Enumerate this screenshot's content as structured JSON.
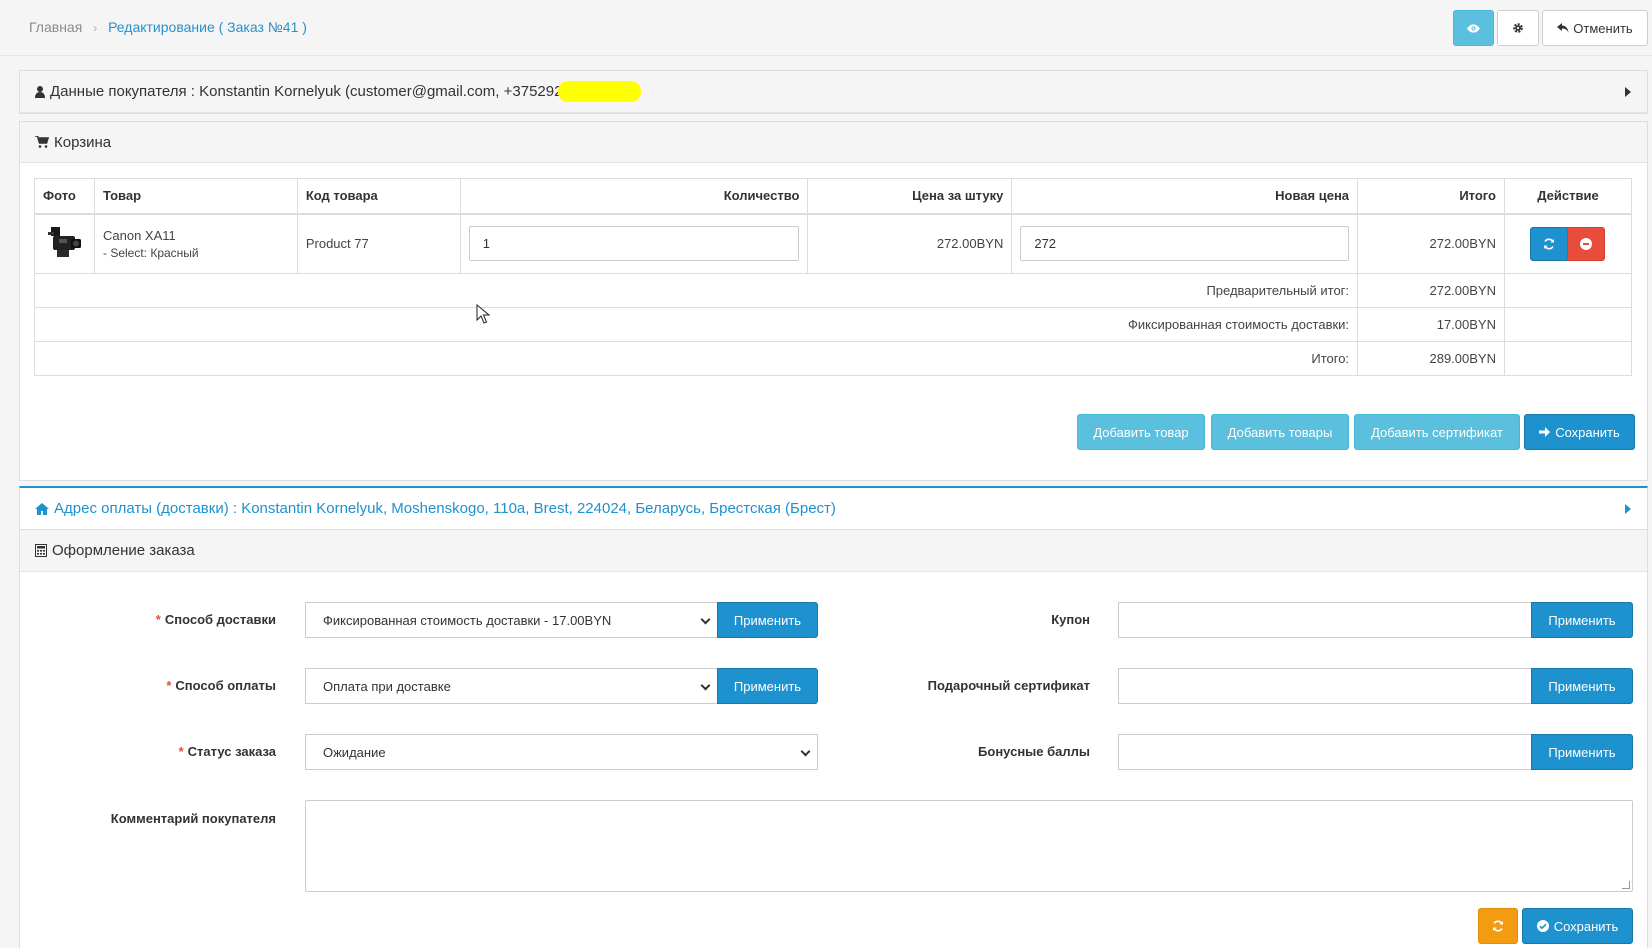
{
  "breadcrumb": {
    "home": "Главная",
    "separator": "›",
    "current": "Редактирование ( Заказ №41 )"
  },
  "header_buttons": {
    "view_icon": "eye-icon",
    "settings_icon": "gear-icon",
    "cancel_label": "Отменить",
    "cancel_icon": "reply-icon"
  },
  "customer_panel": {
    "title": "Данные покупателя : Konstantin Kornelyuk (customer@gmail.com, +375292",
    "redacted": "XXXXXXX"
  },
  "cart_panel": {
    "title": "Корзина",
    "columns": [
      "Фото",
      "Товар",
      "Код товара",
      "Количество",
      "Цена за штуку",
      "Новая цена",
      "Итого",
      "Действие"
    ],
    "item": {
      "name": "Canon XA11",
      "option": "- Select: Красный",
      "code": "Product 77",
      "quantity": "1",
      "unit_price": "272.00BYN",
      "new_price": "272",
      "total": "272.00BYN"
    },
    "totals": [
      {
        "label": "Предварительный итог:",
        "value": "272.00BYN"
      },
      {
        "label": "Фиксированная стоимость доставки:",
        "value": "17.00BYN"
      },
      {
        "label": "Итого:",
        "value": "289.00BYN"
      }
    ],
    "buttons": {
      "add_product": "Добавить товар",
      "add_products": "Добавить товары",
      "add_certificate": "Добавить сертификат",
      "save": "Сохранить"
    }
  },
  "address_panel": {
    "title": "Адрес оплаты (доставки) : Konstantin Kornelyuk, Moshenskogo, 110a, Brest, 224024, Беларусь, Брестская (Брест)"
  },
  "checkout_panel": {
    "title": "Оформление заказа",
    "required_mark": "*",
    "shipping_label": "Способ доставки",
    "shipping_value": "Фиксированная стоимость доставки - 17.00BYN",
    "payment_label": "Способ оплаты",
    "payment_value": "Оплата при доставке",
    "status_label": "Статус заказа",
    "status_value": "Ожидание",
    "comment_label": "Комментарий покупателя",
    "coupon_label": "Купон",
    "voucher_label": "Подарочный сертификат",
    "reward_label": "Бонусные баллы",
    "apply_label": "Применить",
    "save_label": "Сохранить"
  },
  "colors": {
    "primary": "#1e91cf",
    "info": "#5bc0de",
    "danger": "#e74c3c",
    "warning": "#f39c12"
  }
}
